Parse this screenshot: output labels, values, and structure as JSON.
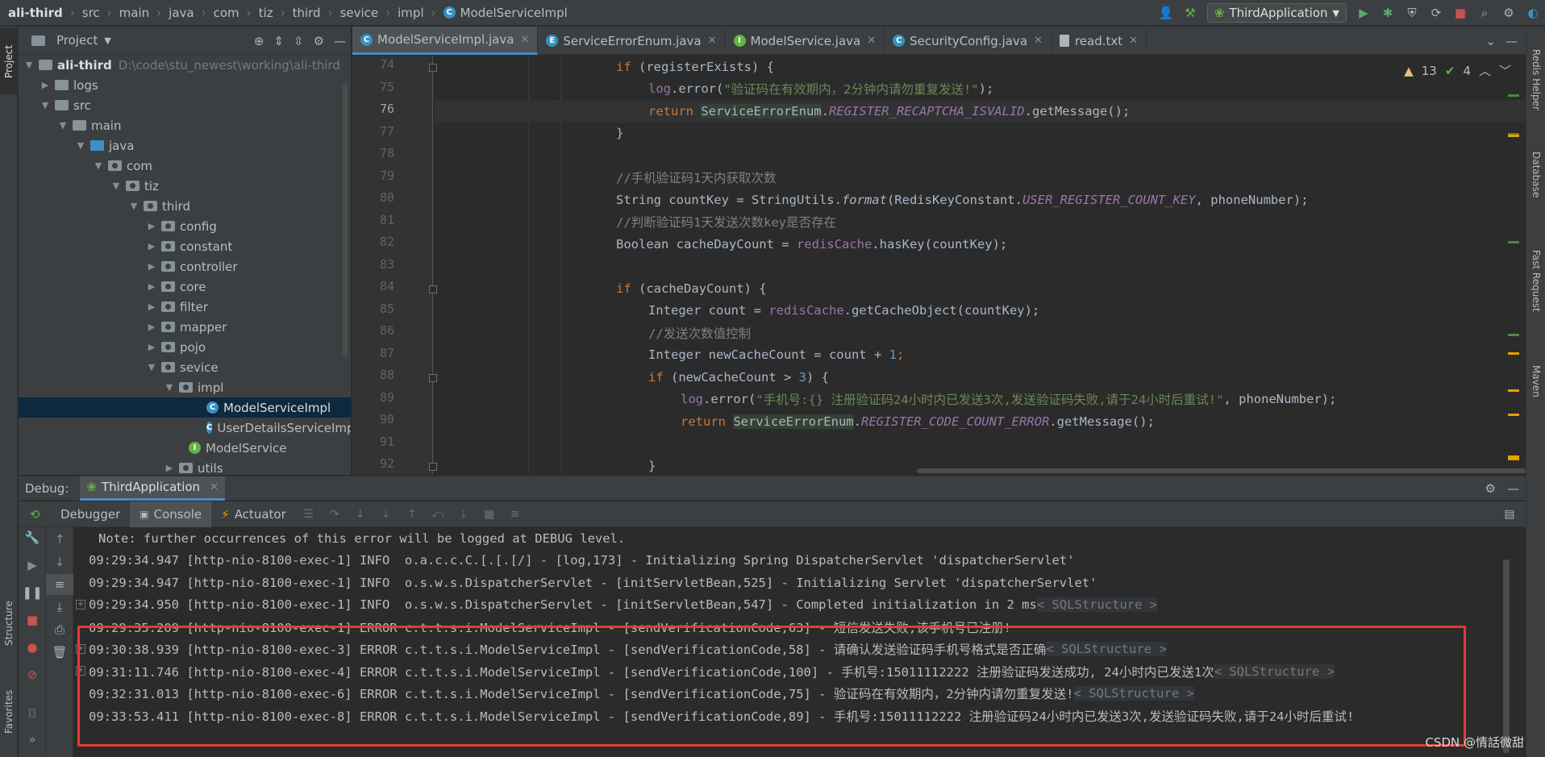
{
  "navbar": {
    "breadcrumbs": [
      "ali-third",
      "src",
      "main",
      "java",
      "com",
      "tiz",
      "third",
      "sevice",
      "impl",
      "ModelServiceImpl"
    ],
    "run_config": "ThirdApplication"
  },
  "left_strip": {
    "project_tab": "Project",
    "structure_tab": "Structure",
    "favorites_tab": "Favorites"
  },
  "right_strip": {
    "tabs": [
      "Redis Helper",
      "Database",
      "Fast Request",
      "Maven"
    ]
  },
  "project": {
    "title": "Project",
    "root": {
      "name": "ali-third",
      "path": "D:\\code\\stu_newest\\working\\ali-third"
    },
    "nodes": [
      {
        "label": "logs"
      },
      {
        "label": "src"
      },
      {
        "label": "main"
      },
      {
        "label": "java"
      },
      {
        "label": "com"
      },
      {
        "label": "tiz"
      },
      {
        "label": "third"
      },
      {
        "label": "config"
      },
      {
        "label": "constant"
      },
      {
        "label": "controller"
      },
      {
        "label": "core"
      },
      {
        "label": "filter"
      },
      {
        "label": "mapper"
      },
      {
        "label": "pojo"
      },
      {
        "label": "sevice"
      },
      {
        "label": "impl"
      },
      {
        "label": "ModelServiceImpl"
      },
      {
        "label": "UserDetailsServiceImpl"
      },
      {
        "label": "ModelService"
      },
      {
        "label": "utils"
      }
    ]
  },
  "editor": {
    "tabs": [
      "ModelServiceImpl.java",
      "ServiceErrorEnum.java",
      "ModelService.java",
      "SecurityConfig.java",
      "read.txt"
    ],
    "warnings": "13",
    "oks": "4",
    "line_numbers": [
      "74",
      "75",
      "76",
      "77",
      "78",
      "79",
      "80",
      "81",
      "82",
      "83",
      "84",
      "85",
      "86",
      "87",
      "88",
      "89",
      "90",
      "91",
      "92"
    ],
    "current_line": "76",
    "code": {
      "l74_a": "if",
      "l74_b": " (registerExists) {",
      "l75_a": "log",
      "l75_b": ".error(",
      "l75_c": "\"验证码在有效期内，2分钟内请勿重复发送!\"",
      "l75_d": ");",
      "l76_a": "return ",
      "l76_b": "ServiceErrorEnum",
      "l76_c": ".",
      "l76_d": "REGISTER_RECAPTCHA_ISVALID",
      "l76_e": ".getMessage();",
      "l77": "}",
      "l79": "//手机验证码1天内获取次数",
      "l80_a": "String countKey = StringUtils.",
      "l80_b": "format",
      "l80_c": "(RedisKeyConstant.",
      "l80_d": "USER_REGISTER_COUNT_KEY",
      "l80_e": ", phoneNumber);",
      "l81": "//判断验证码1天发送次数key是否存在",
      "l82_a": "Boolean cacheDayCount = ",
      "l82_b": "redisCache",
      "l82_c": ".hasKey(countKey);",
      "l84_a": "if",
      "l84_b": " (cacheDayCount) {",
      "l85_a": "Integer count = ",
      "l85_b": "redisCache",
      "l85_c": ".getCacheObject(countKey);",
      "l86": "//发送次数值控制",
      "l87_a": "Integer newCacheCount = count + ",
      "l87_b": "1",
      "l87_c": ";",
      "l88_a": "if",
      "l88_b": " (newCacheCount > ",
      "l88_c": "3",
      "l88_d": ") {",
      "l89_a": "log",
      "l89_b": ".error(",
      "l89_c": "\"手机号:{} 注册验证码24小时内已发送3次,发送验证码失败,请于24小时后重试!\"",
      "l89_d": ", phoneNumber);",
      "l90_a": "return ",
      "l90_b": "ServiceErrorEnum",
      "l90_c": ".",
      "l90_d": "REGISTER_CODE_COUNT_ERROR",
      "l90_e": ".getMessage();",
      "l92": "}"
    }
  },
  "debug": {
    "label": "Debug:",
    "session": "ThirdApplication",
    "tabs": [
      "Debugger",
      "Console",
      "Actuator"
    ],
    "log_lines": [
      "Note: further occurrences of this error will be logged at DEBUG level.",
      "09:29:34.947 [http-nio-8100-exec-1] INFO  o.a.c.c.C.[.[.[/] - [log,173] - Initializing Spring DispatcherServlet 'dispatcherServlet'",
      "09:29:34.947 [http-nio-8100-exec-1] INFO  o.s.w.s.DispatcherServlet - [initServletBean,525] - Initializing Servlet 'dispatcherServlet'",
      "09:29:34.950 [http-nio-8100-exec-1] INFO  o.s.w.s.DispatcherServlet - [initServletBean,547] - Completed initialization in 2 ms",
      "09:29:35.209 [http-nio-8100-exec-1] ERROR c.t.t.s.i.ModelServiceImpl - [sendVerificationCode,63] - 短信发送失败,该手机号已注册!",
      "09:30:38.939 [http-nio-8100-exec-3] ERROR c.t.t.s.i.ModelServiceImpl - [sendVerificationCode,58] - 请确认发送验证码手机号格式是否正确",
      "09:31:11.746 [http-nio-8100-exec-4] ERROR c.t.t.s.i.ModelServiceImpl - [sendVerificationCode,100] - 手机号:15011112222 注册验证码发送成功, 24小时内已发送1次",
      "09:32:31.013 [http-nio-8100-exec-6] ERROR c.t.t.s.i.ModelServiceImpl - [sendVerificationCode,75] - 验证码在有效期内，2分钟内请勿重复发送!",
      "09:33:53.411 [http-nio-8100-exec-8] ERROR c.t.t.s.i.ModelServiceImpl - [sendVerificationCode,89] - 手机号:15011112222 注册验证码24小时内已发送3次,发送验证码失败,请于24小时后重试!"
    ],
    "sql_hint": "< SQLStructure >"
  },
  "watermark": "CSDN @情話微甜",
  "colors": {
    "accent": "#4a88c7",
    "error_box": "#e53935",
    "keyword": "#cc7832",
    "string": "#6a8759",
    "field": "#9876aa"
  }
}
